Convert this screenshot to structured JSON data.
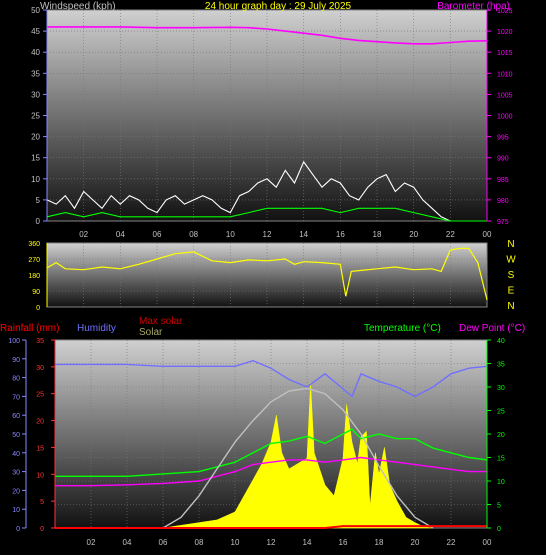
{
  "header": {
    "title": "24 hour graph day : 29 July 2025"
  },
  "colors": {
    "background": "#000000",
    "wind_avg": "#00ff00",
    "wind_gust": "#ffffff",
    "barometer": "#ff00ff",
    "direction": "#ffff00",
    "humidity": "#7070ff",
    "temperature": "#00ff00",
    "dew_point": "#ff00ff",
    "rain": "#ff0000",
    "max_solar": "#c0c0c0",
    "solar": "#ffff00",
    "label_grey": "#c0c0c0"
  },
  "chart_data": [
    {
      "type": "line",
      "ylabel": "Windspeed (kph)",
      "y2label": "Barometer (hpa)",
      "ylim": [
        0,
        50
      ],
      "y2lim": [
        975,
        1025
      ],
      "yticks": [
        "0",
        "5",
        "10",
        "15",
        "20",
        "25",
        "30",
        "35",
        "40",
        "45",
        "50"
      ],
      "y2ticks": [
        "975",
        "980",
        "985",
        "990",
        "995",
        "1000",
        "1005",
        "1010",
        "1015",
        "1020",
        "1025"
      ],
      "xticks": [
        "02",
        "04",
        "06",
        "08",
        "10",
        "12",
        "14",
        "16",
        "18",
        "20",
        "22",
        "00"
      ],
      "grid": true,
      "series": [
        {
          "name": "Barometer (hpa)",
          "axis": "right",
          "color": "#ff00ff",
          "x": [
            0,
            2,
            4,
            6,
            8,
            10,
            11,
            12,
            13,
            14,
            15,
            16,
            17,
            18,
            19,
            20,
            21,
            22,
            23,
            24
          ],
          "values": [
            1021,
            1021,
            1021,
            1020.8,
            1020.8,
            1020.9,
            1020.8,
            1020.5,
            1020,
            1019.5,
            1019,
            1018.3,
            1017.8,
            1017.5,
            1017.2,
            1017,
            1017,
            1017.3,
            1017.6,
            1017.7
          ]
        },
        {
          "color": "#ffffff",
          "x": [
            0,
            0.5,
            1,
            1.5,
            2,
            2.5,
            3,
            3.5,
            4,
            4.5,
            5,
            5.5,
            6,
            6.5,
            7,
            7.5,
            8,
            8.5,
            9,
            9.5,
            10,
            10.5,
            11,
            11.5,
            12,
            12.5,
            13,
            13.5,
            14,
            14.5,
            15,
            15.5,
            16,
            16.5,
            17,
            17.5,
            18,
            18.5,
            19,
            19.5,
            20,
            20.5,
            21,
            21.5,
            22,
            22.5,
            23,
            23.5,
            24
          ],
          "values": [
            5,
            4,
            6,
            3,
            7,
            5,
            3,
            6,
            4,
            6,
            5,
            3,
            2,
            5,
            6,
            4,
            5,
            6,
            5,
            3,
            2,
            6,
            7,
            9,
            10,
            8,
            12,
            9,
            14,
            11,
            8,
            10,
            9,
            6,
            5,
            8,
            10,
            11,
            7,
            9,
            8,
            5,
            3,
            1,
            0,
            0,
            0,
            0,
            0
          ]
        },
        {
          "color": "#00ff00",
          "x": [
            0,
            1,
            2,
            3,
            4,
            5,
            6,
            7,
            8,
            9,
            10,
            11,
            12,
            13,
            14,
            15,
            16,
            17,
            18,
            19,
            20,
            21,
            22,
            23,
            24
          ],
          "values": [
            1,
            2,
            1,
            2,
            1,
            1,
            1,
            1,
            1,
            1,
            1,
            2,
            3,
            3,
            3,
            3,
            2,
            3,
            3,
            3,
            2,
            1,
            0,
            0,
            0
          ]
        }
      ]
    },
    {
      "type": "line",
      "yticks": [
        "0",
        "90",
        "180",
        "270",
        "360"
      ],
      "compass": [
        "N",
        "W",
        "S",
        "E",
        "N"
      ],
      "ylim": [
        0,
        360
      ],
      "xticks": [
        "02",
        "04",
        "06",
        "08",
        "10",
        "12",
        "14",
        "16",
        "18",
        "20",
        "22",
        "00"
      ],
      "series": [
        {
          "color": "#ffff00",
          "x": [
            0,
            0.5,
            1,
            2,
            3,
            4,
            5,
            6,
            7,
            8,
            9,
            10,
            11,
            12,
            13,
            13.5,
            14,
            15,
            16,
            16.3,
            16.6,
            17,
            18,
            19,
            20,
            21,
            21.5,
            22,
            22.5,
            23,
            23.5,
            24
          ],
          "values": [
            220,
            250,
            215,
            210,
            225,
            215,
            240,
            270,
            300,
            310,
            260,
            250,
            265,
            260,
            270,
            240,
            255,
            250,
            240,
            60,
            200,
            205,
            215,
            225,
            210,
            215,
            200,
            320,
            330,
            330,
            250,
            40
          ]
        }
      ]
    },
    {
      "type": "area",
      "legend": [
        "Rainfall (mm)",
        "Humidity",
        "Max solar",
        "Solar",
        "Temperature (°C)",
        "Dew Point (°C)"
      ],
      "y_left1_ticks": [
        "0",
        "10",
        "20",
        "30",
        "40",
        "50",
        "60",
        "70",
        "80",
        "90",
        "100"
      ],
      "y_left2_ticks": [
        "0",
        "5",
        "10",
        "15",
        "20",
        "25",
        "30",
        "35"
      ],
      "y_right_ticks": [
        "0",
        "5",
        "10",
        "15",
        "20",
        "25",
        "30",
        "35",
        "40"
      ],
      "y_left1_lim": [
        0,
        100
      ],
      "y_left2_lim": [
        0,
        35
      ],
      "y_right_lim": [
        0,
        40
      ],
      "xticks": [
        "02",
        "04",
        "06",
        "08",
        "10",
        "12",
        "14",
        "16",
        "18",
        "20",
        "22",
        "00"
      ],
      "grid": true,
      "series": [
        {
          "name": "Humidity",
          "axis": "left1",
          "color": "#7070ff",
          "x": [
            0,
            2,
            4,
            6,
            8,
            10,
            11,
            12,
            13,
            14,
            15,
            16,
            16.5,
            17,
            18,
            19,
            20,
            21,
            22,
            23,
            24
          ],
          "values": [
            87,
            87,
            87,
            86,
            86,
            86,
            89,
            85,
            79,
            75,
            82,
            74,
            70,
            82,
            78,
            75,
            70,
            75,
            82,
            85,
            86
          ]
        },
        {
          "name": "Temperature (°C)",
          "axis": "right",
          "color": "#00ff00",
          "x": [
            0,
            2,
            4,
            6,
            8,
            10,
            11,
            12,
            13,
            14,
            15,
            16,
            16.5,
            17,
            18,
            19,
            20,
            21,
            22,
            23,
            24
          ],
          "values": [
            11,
            11,
            11,
            11.5,
            12,
            14,
            16,
            18,
            18.5,
            19.5,
            18,
            20,
            21,
            19,
            20,
            19,
            19,
            17,
            16,
            15,
            14.5
          ]
        },
        {
          "name": "Dew Point (°C)",
          "axis": "right",
          "color": "#ff00ff",
          "x": [
            0,
            2,
            4,
            6,
            8,
            10,
            11,
            12,
            13,
            14,
            15,
            16,
            17,
            18,
            19,
            20,
            21,
            22,
            23,
            24
          ],
          "values": [
            9,
            9,
            9.2,
            9.5,
            10,
            12,
            13.5,
            14,
            14.5,
            14.5,
            14,
            14.5,
            15,
            14.5,
            14,
            13.5,
            13,
            12.5,
            12,
            12
          ]
        },
        {
          "name": "Max solar",
          "axis": "left2",
          "color": "#c0c0c0",
          "x": [
            6,
            7,
            8,
            9,
            10,
            11,
            12,
            13,
            14,
            15,
            16,
            17,
            18,
            19,
            20,
            21
          ],
          "values": [
            0,
            2,
            6,
            11,
            16,
            20,
            23.5,
            25.5,
            26,
            25,
            22,
            17.5,
            11.5,
            6,
            2,
            0
          ]
        },
        {
          "name": "Solar",
          "axis": "left2",
          "color": "#ffff00",
          "x": [
            6,
            7,
            8,
            9,
            10,
            10.5,
            11,
            11.5,
            12,
            12.3,
            12.6,
            13,
            13.5,
            14,
            14.2,
            14.4,
            15,
            15.5,
            16,
            16.2,
            16.5,
            16.8,
            17,
            17.3,
            17.5,
            17.8,
            18,
            18.3,
            18.6,
            19,
            19.5,
            20,
            20.5,
            21
          ],
          "values": [
            0,
            0.5,
            1,
            1.5,
            3,
            6,
            9,
            12,
            16,
            21,
            14,
            11,
            12,
            13,
            27,
            14,
            8,
            6,
            13,
            23,
            16,
            12,
            17,
            18,
            4,
            14,
            10,
            15,
            8,
            5,
            2,
            1,
            0.2,
            0
          ]
        },
        {
          "name": "Rainfall (mm)",
          "axis": "left1",
          "color": "#ff0000",
          "x": [
            0,
            15,
            16,
            24
          ],
          "values": [
            0,
            0,
            1,
            1
          ]
        }
      ]
    }
  ]
}
